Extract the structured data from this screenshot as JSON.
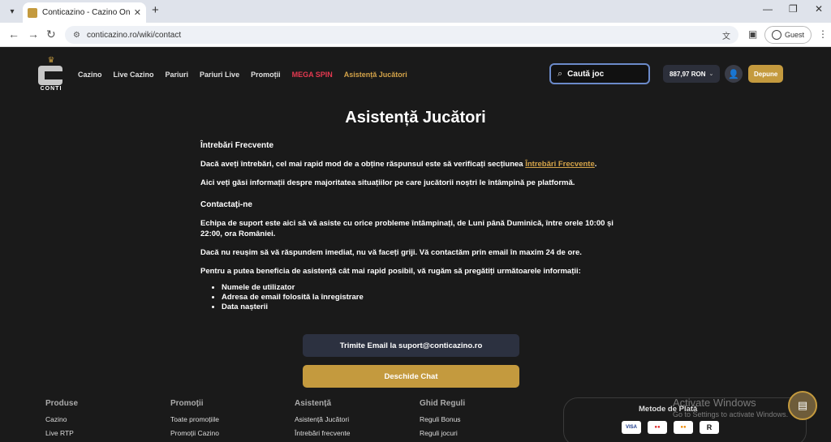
{
  "browser": {
    "tab_title": "Conticazino - Cazino Online Ro",
    "tab_close": "✕",
    "new_tab": "+",
    "url": "conticazino.ro/wiki/contact",
    "profile": "Guest",
    "window_controls": [
      "—",
      "❐",
      "✕"
    ]
  },
  "header": {
    "logo_text": "CONTI",
    "nav": [
      "Cazino",
      "Live Cazino",
      "Pariuri",
      "Pariuri Live",
      "Promoții"
    ],
    "nav_mega": "MEGA SPIN",
    "nav_active": "Asistență Jucători",
    "search_placeholder": "Caută joc",
    "balance": "887,97 RON",
    "deposit": "Depune"
  },
  "main": {
    "title": "Asistență Jucători",
    "faq_heading": "Întrebări Frecvente",
    "faq_p1_pre": "Dacă aveți întrebări, cel mai rapid mod de a obține răspunsul este să verificați secțiunea ",
    "faq_p1_link": "Întrebări Frecvente",
    "faq_p1_post": ".",
    "faq_p2": "Aici veți găsi informații despre majoritatea situațiilor pe care jucătorii noștri le întâmpină pe platformă.",
    "contact_heading": "Contactați-ne",
    "contact_p1": "Echipa de suport este aici să vă asiste cu orice probleme întâmpinați, de Luni până Duminică, între orele 10:00 și 22:00, ora României.",
    "contact_p2": "Dacă nu reușim să vă răspundem imediat, nu vă faceți griji. Vă contactăm prin email  în maxim  24 de ore.",
    "contact_p3": "Pentru a putea beneficia de asistență cât mai rapid posibil, vă rugăm să pregătiți următoarele informații:",
    "list": [
      "Numele de utilizator",
      "Adresa de email folosită la înregistrare",
      "Data nașterii"
    ],
    "email_button": "Trimite Email la suport@conticazino.ro",
    "chat_button": "Deschide Chat"
  },
  "footer": {
    "columns": [
      {
        "head": "Produse",
        "links": [
          "Cazino",
          "Live RTP"
        ]
      },
      {
        "head": "Promoții",
        "links": [
          "Toate promoțiile",
          "Promoții Cazino"
        ]
      },
      {
        "head": "Asistență",
        "links": [
          "Asistență Jucători",
          "Întrebări frecvente"
        ]
      },
      {
        "head": "Ghid Reguli",
        "links": [
          "Reguli Bonus",
          "Reguli jocuri"
        ]
      }
    ],
    "payment_title": "Metode de Plată",
    "payment_icons": [
      "VISA",
      "maestro",
      "mastercard",
      "R"
    ]
  },
  "watermark": {
    "line1": "Activate Windows",
    "line2": "Go to Settings to activate Windows."
  },
  "colors": {
    "accent": "#c49a3e",
    "mega": "#e53950",
    "background": "#1a1a1a"
  }
}
